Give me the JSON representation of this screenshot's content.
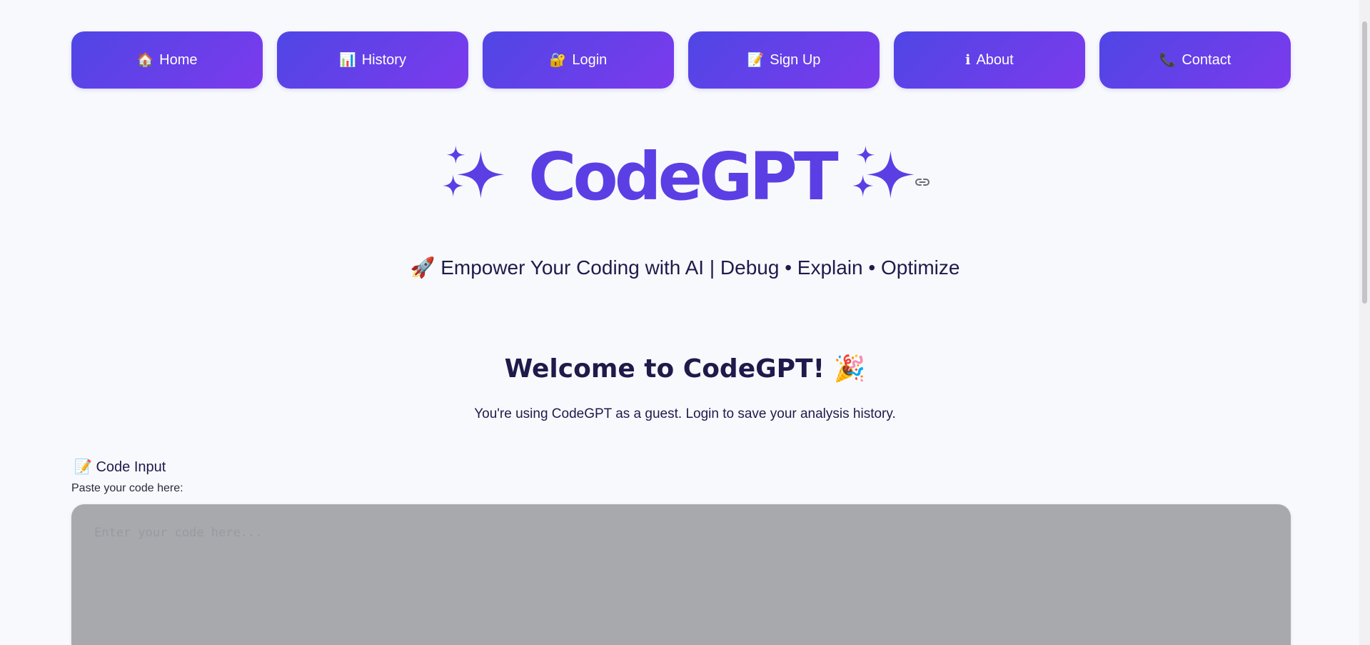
{
  "nav": [
    {
      "icon": "🏠",
      "label": "Home"
    },
    {
      "icon": "📊",
      "label": "History"
    },
    {
      "icon": "🔐",
      "label": "Login"
    },
    {
      "icon": "📝",
      "label": "Sign Up"
    },
    {
      "icon": "ℹ",
      "label": "About"
    },
    {
      "icon": "📞",
      "label": "Contact"
    }
  ],
  "header": {
    "title": "CodeGPT",
    "tagline": "🚀 Empower Your Coding with AI | Debug • Explain • Optimize"
  },
  "welcome": {
    "heading": "Welcome to CodeGPT! 🎉",
    "note": "You're using CodeGPT as a guest. Login to save your analysis history."
  },
  "code_input": {
    "section_title": "📝 Code Input",
    "label": "Paste your code here:",
    "placeholder": "Enter your code here...",
    "value": ""
  },
  "colors": {
    "brand": "#5b3fe4",
    "button_gradient_start": "#4f46e5",
    "button_gradient_end": "#7c3aed",
    "background": "#f8f9fd",
    "text": "#1e1b4b"
  }
}
